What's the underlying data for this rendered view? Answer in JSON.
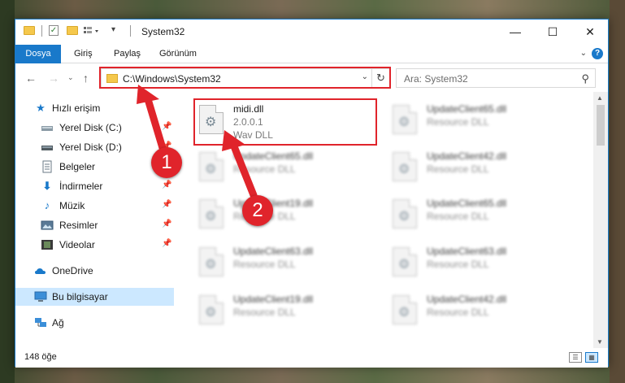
{
  "window": {
    "title": "System32",
    "controls": [
      "minimize-icon",
      "maximize-icon",
      "close-icon"
    ]
  },
  "ribbon": {
    "tabs": [
      "Dosya",
      "Giriş",
      "Paylaş",
      "Görünüm"
    ],
    "active_tab": "Dosya",
    "help": "?"
  },
  "address": {
    "path": "C:\\Windows\\System32",
    "refresh": "↻"
  },
  "search": {
    "placeholder": "Ara: System32"
  },
  "nav": {
    "items": [
      {
        "label": "Hızlı erişim",
        "icon": "star-icon",
        "pinned": false
      },
      {
        "label": "Yerel Disk (C:)",
        "icon": "drive-icon",
        "pinned": true
      },
      {
        "label": "Yerel Disk (D:)",
        "icon": "drive-icon",
        "pinned": true
      },
      {
        "label": "Belgeler",
        "icon": "documents-icon",
        "pinned": true
      },
      {
        "label": "İndirmeler",
        "icon": "download-icon",
        "pinned": true
      },
      {
        "label": "Müzik",
        "icon": "music-icon",
        "pinned": true
      },
      {
        "label": "Resimler",
        "icon": "pictures-icon",
        "pinned": true
      },
      {
        "label": "Videolar",
        "icon": "videos-icon",
        "pinned": true
      },
      {
        "label": "OneDrive",
        "icon": "cloud-icon",
        "pinned": false
      },
      {
        "label": "Bu bilgisayar",
        "icon": "computer-icon",
        "pinned": false,
        "selected": true
      },
      {
        "label": "Ağ",
        "icon": "network-icon",
        "pinned": false
      }
    ]
  },
  "files": {
    "highlighted": {
      "name": "midi.dll",
      "version": "2.0.0.1",
      "type": "Wav DLL"
    },
    "left_column": [
      {
        "name": "UpdateClient65.dll",
        "type": "Resource DLL"
      },
      {
        "name": "UpdateClient19.dll",
        "type": "Resource DLL"
      },
      {
        "name": "UpdateClient63.dll",
        "type": "Resource DLL"
      },
      {
        "name": "UpdateClient19.dll",
        "type": "Resource DLL"
      }
    ],
    "right_column": [
      {
        "name": "UpdateClient65.dll",
        "type": "Resource DLL"
      },
      {
        "name": "UpdateClient42.dll",
        "type": "Resource DLL"
      },
      {
        "name": "UpdateClient65.dll",
        "type": "Resource DLL"
      },
      {
        "name": "UpdateClient63.dll",
        "type": "Resource DLL"
      },
      {
        "name": "UpdateClient42.dll",
        "type": "Resource DLL"
      }
    ]
  },
  "status": {
    "item_count": "148 öğe"
  },
  "annotations": {
    "step1": "1",
    "step2": "2",
    "color": "#e0242b"
  }
}
